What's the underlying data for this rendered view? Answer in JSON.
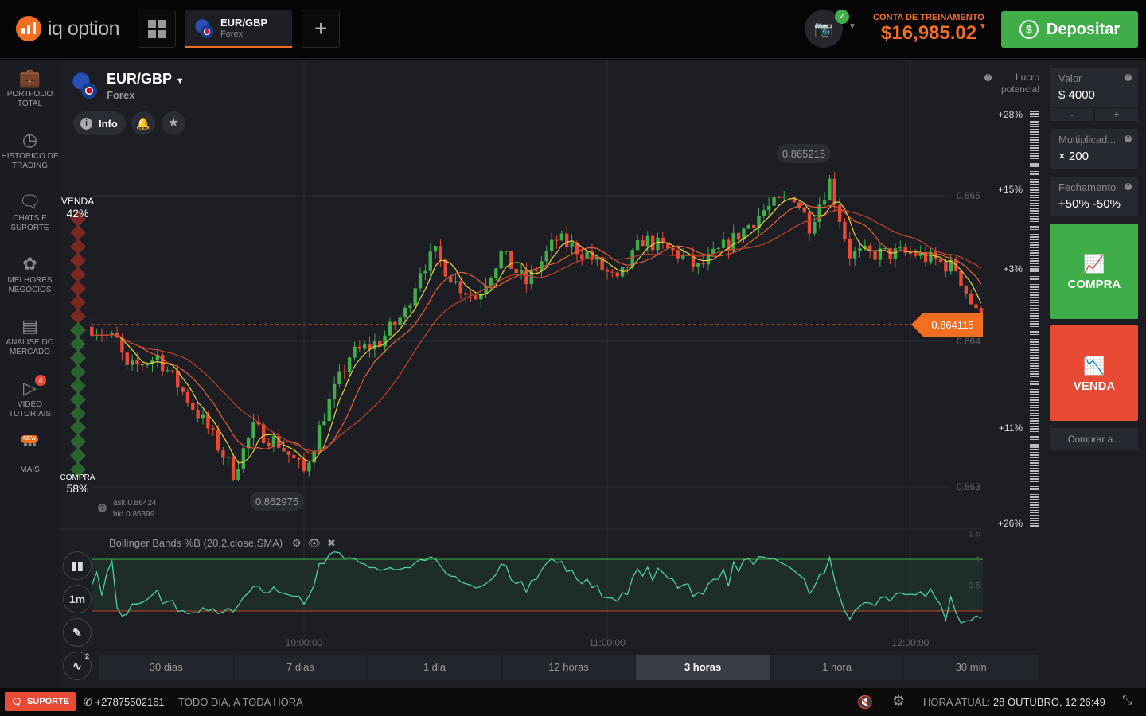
{
  "header": {
    "logo_text": "iq option",
    "asset_tab": {
      "name": "EUR/GBP",
      "type": "Forex"
    },
    "account_label": "CONTA DE TREINAMENTO",
    "balance": "$16,985.02",
    "deposit_label": "Depositar"
  },
  "sidebar": {
    "items": [
      {
        "label": "PORTFOLIO TOTAL",
        "icon": "briefcase-icon"
      },
      {
        "label": "HISTORICO DE TRADING",
        "icon": "history-icon"
      },
      {
        "label": "CHATS E SUPORTE",
        "icon": "chat-icon"
      },
      {
        "label": "MELHORES NEGÓCIOS",
        "icon": "award-icon"
      },
      {
        "label": "ANALISE DO MERCADO",
        "icon": "news-icon"
      },
      {
        "label": "VIDEO TUTORIAIS",
        "icon": "play-icon",
        "badge": "4"
      },
      {
        "label": "MAIS",
        "icon": "more-icon",
        "badge": "NEW"
      }
    ]
  },
  "asset": {
    "name": "EUR/GBP",
    "type": "Forex",
    "info_label": "Info"
  },
  "sentiment": {
    "sell_label": "VENDA",
    "sell_pct": "42%",
    "buy_label": "COMPRA",
    "buy_pct": "58%",
    "sell_fraction": 0.42
  },
  "quote": {
    "ask": "ask 0.86424",
    "bid": "bid 0.86399"
  },
  "chart": {
    "price_labels": [
      "0.865",
      "0.864",
      "0.863"
    ],
    "current_price": "0.864115",
    "high_label": "0.865215",
    "low_label": "0.862975",
    "time_labels": [
      "10:00:00",
      "11:00:00",
      "12:00:00"
    ],
    "price_path": [
      [
        "09:18",
        0.8641
      ],
      [
        "09:23",
        0.864
      ],
      [
        "09:25",
        0.8638
      ],
      [
        "09:31",
        0.8639
      ],
      [
        "09:41",
        0.8634
      ],
      [
        "09:46",
        0.8631
      ],
      [
        "09:50",
        0.8634
      ],
      [
        "09:55",
        0.8633
      ],
      [
        "10:00",
        0.8631
      ],
      [
        "10:04",
        0.8635
      ],
      [
        "10:09",
        0.8639
      ],
      [
        "10:15",
        0.864
      ],
      [
        "10:20",
        0.8642
      ],
      [
        "10:23",
        0.8645
      ],
      [
        "10:26",
        0.8646
      ],
      [
        "10:30",
        0.8644
      ],
      [
        "10:34",
        0.8643
      ],
      [
        "10:39",
        0.8646
      ],
      [
        "10:44",
        0.8644
      ],
      [
        "10:50",
        0.8647
      ],
      [
        "10:56",
        0.8646
      ],
      [
        "11:02",
        0.8644
      ],
      [
        "11:07",
        0.8647
      ],
      [
        "11:14",
        0.8646
      ],
      [
        "11:18",
        0.8645
      ],
      [
        "11:25",
        0.8647
      ],
      [
        "11:31",
        0.8649
      ],
      [
        "11:37",
        0.865
      ],
      [
        "11:40",
        0.8648
      ],
      [
        "11:44",
        0.8651
      ],
      [
        "11:48",
        0.8646
      ],
      [
        "11:53",
        0.8646
      ],
      [
        "12:01",
        0.8646
      ],
      [
        "12:09",
        0.8645
      ],
      [
        "12:14",
        0.86411
      ]
    ],
    "colors": {
      "up": "#3fae49",
      "down": "#e84a35",
      "ma_fast": "#e8d43a",
      "ma_mid": "#e8603a",
      "ma_slow": "#c8402e",
      "current": "#f26f21"
    }
  },
  "indicator": {
    "title": "Bollinger Bands %B (20,2,close,SMA)",
    "levels": [
      "1.5",
      "1",
      "0.5"
    ],
    "timeframe": "1m",
    "drawing_count": "2"
  },
  "profit": {
    "title_line1": "Lucro",
    "title_line2": "potencial",
    "levels": [
      "+28%",
      "+15%",
      "+3%",
      "+11%",
      "+26%"
    ]
  },
  "trade": {
    "amount_label": "Valor",
    "amount": "$  4000",
    "minus": "-",
    "plus": "+",
    "mult_label": "Multiplicad...",
    "mult": "× 200",
    "close_label": "Fechamento",
    "close": "+50% -50%",
    "buy": "COMPRA",
    "sell": "VENDA",
    "buy_at": "Comprar a..."
  },
  "periods": [
    "30 dias",
    "7 dias",
    "1 dia",
    "12 horas",
    "3 horas",
    "1 hora",
    "30 min"
  ],
  "active_period": "3 horas",
  "footer": {
    "support": "SUPORTE",
    "phone": "+27875502161",
    "hours": "TODO DIA, A TODA HORA",
    "time_label": "HORA ATUAL:",
    "time": "28 OUTUBRO, 12:26:49"
  }
}
